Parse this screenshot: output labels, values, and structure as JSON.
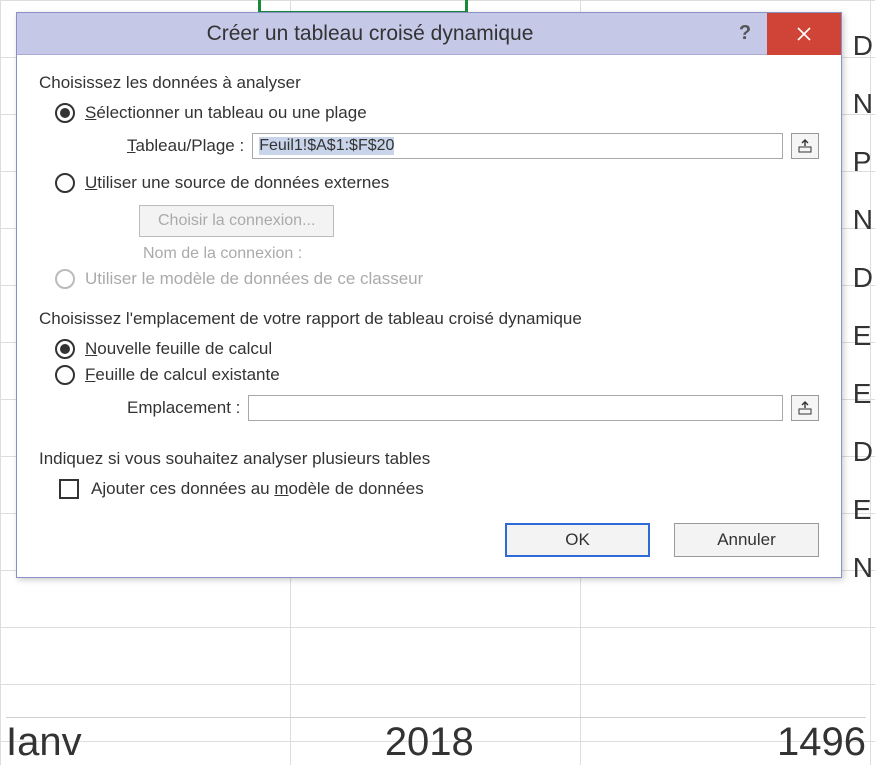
{
  "background": {
    "letters": [
      "D",
      "N",
      "P",
      "N",
      "D",
      "E",
      "E",
      "D",
      "E",
      "N"
    ],
    "bottom_left": "Ianv",
    "bottom_mid": "2018",
    "bottom_right": "1496"
  },
  "dialog": {
    "title": "Créer un tableau croisé dynamique",
    "section1": "Choisissez les données à analyser",
    "radio_select_prefix": "S",
    "radio_select_rest": "électionner un tableau ou une plage",
    "tbl_label_prefix": "T",
    "tbl_label_rest": "ableau/Plage :",
    "range_value": "Feuil1!$A$1:$F$20",
    "radio_external_prefix": "U",
    "radio_external_rest": "tiliser une source de données externes",
    "choose_conn": "Choisir la connexion...",
    "conn_name": "Nom de la connexion :",
    "radio_model": "Utiliser le modèle de données de ce classeur",
    "section2": "Choisissez l'emplacement de votre rapport de tableau croisé dynamique",
    "radio_newsheet_prefix": "N",
    "radio_newsheet_rest": "ouvelle feuille de calcul",
    "radio_existing_prefix": "F",
    "radio_existing_rest": "euille de calcul existante",
    "loc_label": "Emplacement :",
    "section3": "Indiquez si vous souhaitez analyser plusieurs tables",
    "chk_model_pre": "Ajouter ces données au ",
    "chk_model_u": "m",
    "chk_model_post": "odèle de données",
    "ok": "OK",
    "cancel": "Annuler"
  }
}
